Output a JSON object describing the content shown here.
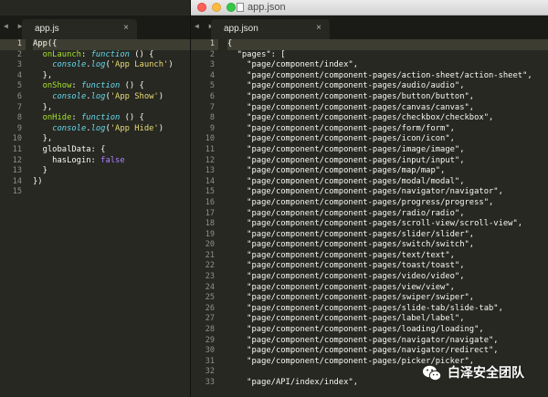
{
  "window": {
    "title": "app.json"
  },
  "left_editor": {
    "tab": {
      "label": "app.js",
      "close": "×"
    },
    "lines": [
      [
        [
          "plain",
          "App({"
        ]
      ],
      [
        [
          "plain",
          "  "
        ],
        [
          "fn",
          "onLaunch"
        ],
        [
          "plain",
          ": "
        ],
        [
          "kw",
          "function"
        ],
        [
          "plain",
          " () {"
        ]
      ],
      [
        [
          "plain",
          "    "
        ],
        [
          "kw",
          "console"
        ],
        [
          "plain",
          "."
        ],
        [
          "kw",
          "log"
        ],
        [
          "plain",
          "("
        ],
        [
          "str",
          "'App Launch'"
        ],
        [
          "plain",
          ")"
        ]
      ],
      [
        [
          "plain",
          "  },"
        ]
      ],
      [
        [
          "plain",
          "  "
        ],
        [
          "fn",
          "onShow"
        ],
        [
          "plain",
          ": "
        ],
        [
          "kw",
          "function"
        ],
        [
          "plain",
          " () {"
        ]
      ],
      [
        [
          "plain",
          "    "
        ],
        [
          "kw",
          "console"
        ],
        [
          "plain",
          "."
        ],
        [
          "kw",
          "log"
        ],
        [
          "plain",
          "("
        ],
        [
          "str",
          "'App Show'"
        ],
        [
          "plain",
          ")"
        ]
      ],
      [
        [
          "plain",
          "  },"
        ]
      ],
      [
        [
          "plain",
          "  "
        ],
        [
          "fn",
          "onHide"
        ],
        [
          "plain",
          ": "
        ],
        [
          "kw",
          "function"
        ],
        [
          "plain",
          " () {"
        ]
      ],
      [
        [
          "plain",
          "    "
        ],
        [
          "kw",
          "console"
        ],
        [
          "plain",
          "."
        ],
        [
          "kw",
          "log"
        ],
        [
          "plain",
          "("
        ],
        [
          "str",
          "'App Hide'"
        ],
        [
          "plain",
          ")"
        ]
      ],
      [
        [
          "plain",
          "  },"
        ]
      ],
      [
        [
          "plain",
          "  globalData: {"
        ]
      ],
      [
        [
          "plain",
          "    hasLogin: "
        ],
        [
          "cst",
          "false"
        ]
      ],
      [
        [
          "plain",
          "  }"
        ]
      ],
      [
        [
          "plain",
          "})"
        ]
      ],
      [
        [
          "plain",
          ""
        ]
      ]
    ]
  },
  "right_editor": {
    "tab": {
      "label": "app.json",
      "close": "×"
    },
    "lines": [
      "{",
      "  \"pages\": [",
      "    \"page/component/index\",",
      "    \"page/component/component-pages/action-sheet/action-sheet\",",
      "    \"page/component/component-pages/audio/audio\",",
      "    \"page/component/component-pages/button/button\",",
      "    \"page/component/component-pages/canvas/canvas\",",
      "    \"page/component/component-pages/checkbox/checkbox\",",
      "    \"page/component/component-pages/form/form\",",
      "    \"page/component/component-pages/icon/icon\",",
      "    \"page/component/component-pages/image/image\",",
      "    \"page/component/component-pages/input/input\",",
      "    \"page/component/component-pages/map/map\",",
      "    \"page/component/component-pages/modal/modal\",",
      "    \"page/component/component-pages/navigator/navigator\",",
      "    \"page/component/component-pages/progress/progress\",",
      "    \"page/component/component-pages/radio/radio\",",
      "    \"page/component/component-pages/scroll-view/scroll-view\",",
      "    \"page/component/component-pages/slider/slider\",",
      "    \"page/component/component-pages/switch/switch\",",
      "    \"page/component/component-pages/text/text\",",
      "    \"page/component/component-pages/toast/toast\",",
      "    \"page/component/component-pages/video/video\",",
      "    \"page/component/component-pages/view/view\",",
      "    \"page/component/component-pages/swiper/swiper\",",
      "    \"page/component/component-pages/slide-tab/slide-tab\",",
      "    \"page/component/component-pages/label/label\",",
      "    \"page/component/component-pages/loading/loading\",",
      "    \"page/component/component-pages/navigator/navigate\",",
      "    \"page/component/component-pages/navigator/redirect\",",
      "    \"page/component/component-pages/picker/picker\",",
      "",
      "    \"page/API/index/index\","
    ]
  },
  "watermark": {
    "text": "白泽安全团队",
    "logo": "wechat-icon"
  },
  "colors": {
    "editor_bg": "#272822",
    "keyword": "#66d9ef",
    "function": "#a6e22e",
    "string": "#e6db74",
    "constant": "#ae81ff"
  }
}
